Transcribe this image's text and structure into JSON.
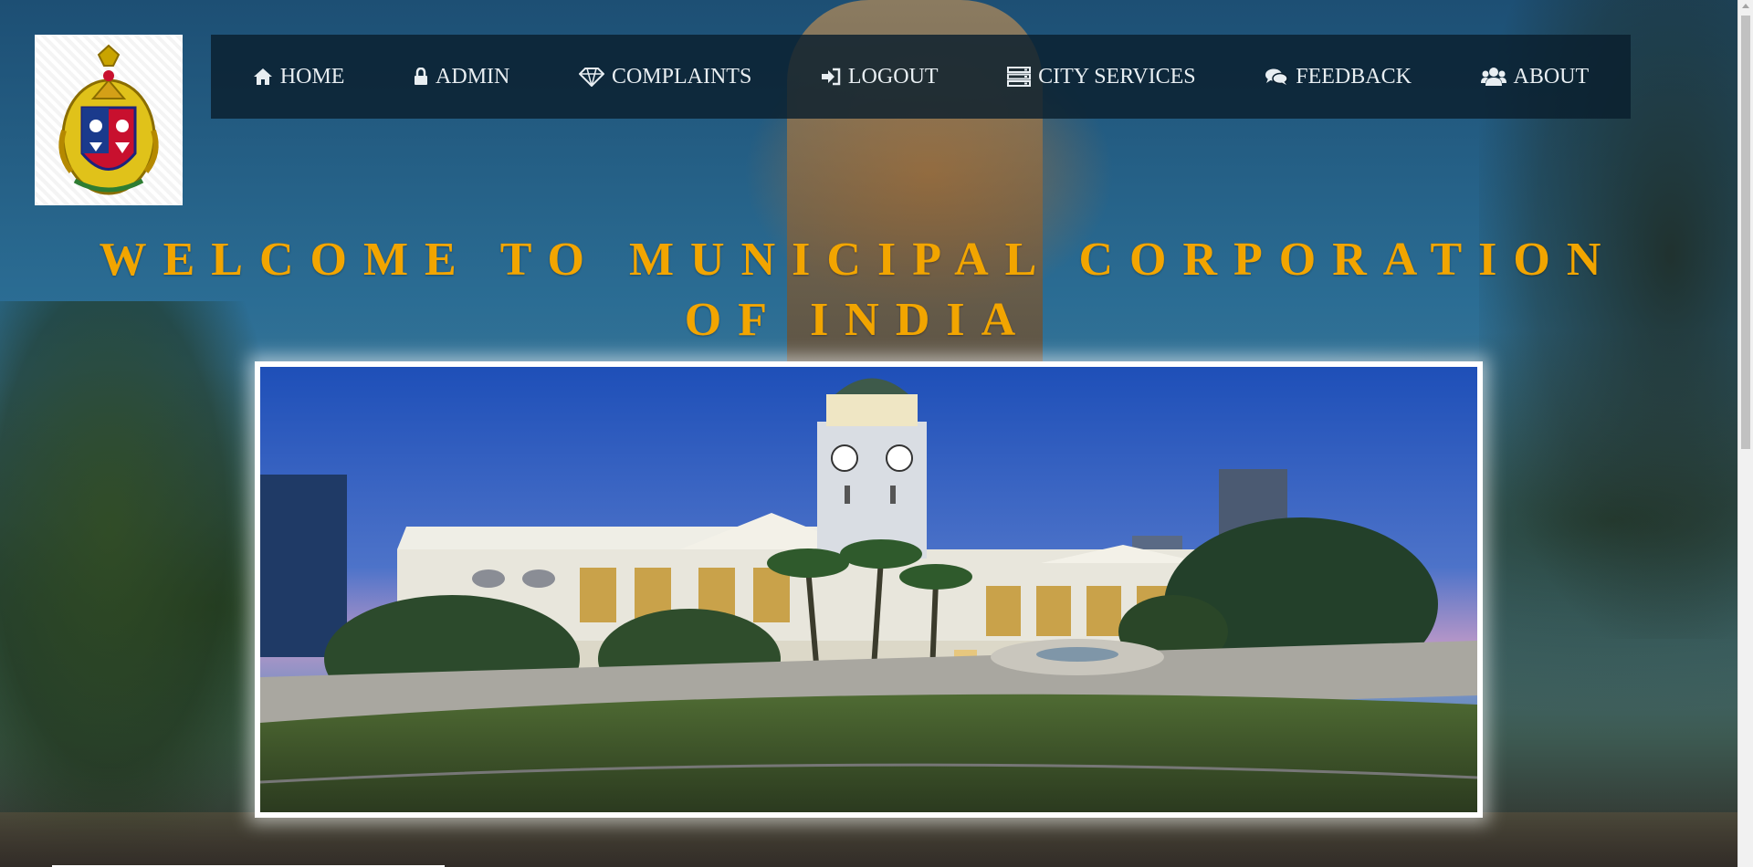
{
  "logo": {
    "icon": "municipal-emblem-icon"
  },
  "nav": {
    "items": [
      {
        "label": "HOME",
        "icon": "home-icon"
      },
      {
        "label": "ADMIN",
        "icon": "lock-icon"
      },
      {
        "label": "COMPLAINTS",
        "icon": "diamond-icon"
      },
      {
        "label": "LOGOUT",
        "icon": "sign-in-icon"
      },
      {
        "label": "CITY SERVICES",
        "icon": "server-icon"
      },
      {
        "label": "FEEDBACK",
        "icon": "comments-icon"
      },
      {
        "label": "ABOUT",
        "icon": "users-icon"
      }
    ]
  },
  "hero": {
    "title": "WELCOME TO MUNICIPAL CORPORATION OF INDIA",
    "image": "city-hall-photo"
  },
  "colors": {
    "title": "#f2a500",
    "nav_background": "#0a1e2d",
    "nav_text": "#e8eef2"
  }
}
